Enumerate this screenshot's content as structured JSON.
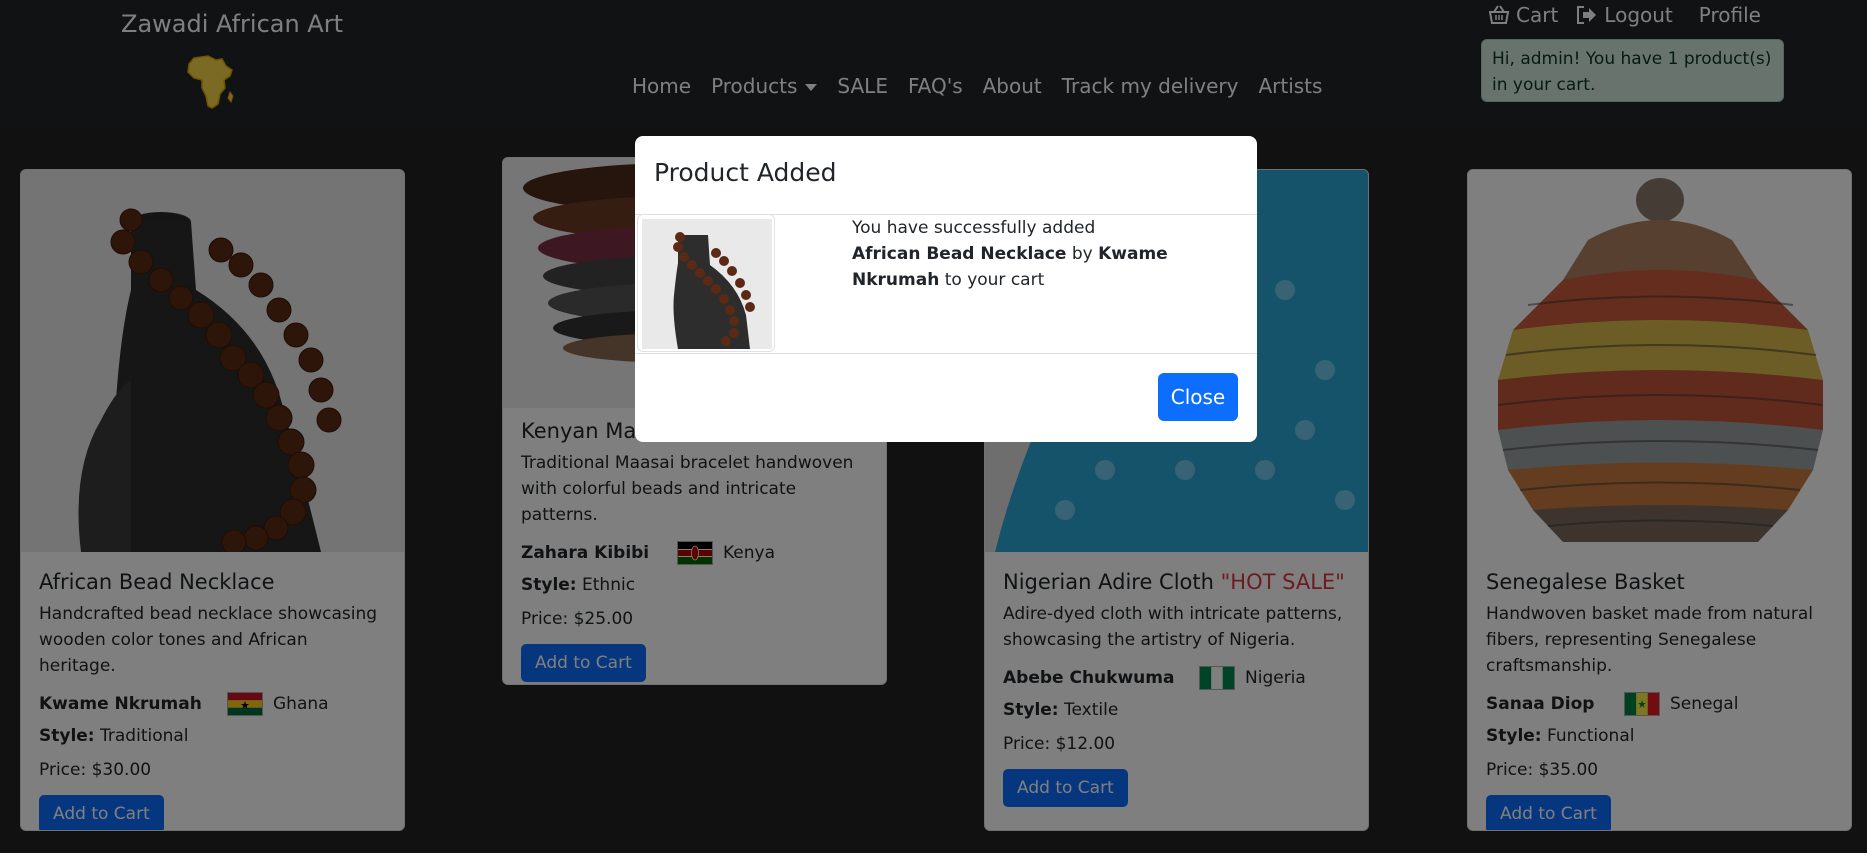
{
  "navbar": {
    "brand": "Zawadi African Art",
    "links": [
      "Home",
      "Products",
      "SALE",
      "FAQ's",
      "About",
      "Track my delivery",
      "Artists"
    ],
    "cart_label": "Cart",
    "logout_label": "Logout",
    "profile_label": "Profile",
    "alert_text": "Hi, admin! You have 1 product(s) in your cart."
  },
  "products": [
    {
      "name": "African Bead Necklace",
      "sale_tag": "",
      "description": "Handcrafted bead necklace showcasing wooden color tones and African heritage.",
      "artist": "Kwame Nkrumah",
      "country": "Ghana",
      "style_label": "Style:",
      "style": "Traditional",
      "price": "Price: $30.00",
      "button": "Add to Cart"
    },
    {
      "name": "Kenyan Maasai Bracelet",
      "sale_tag": "",
      "description": "Traditional Maasai bracelet handwoven with colorful beads and intricate patterns.",
      "artist": "Zahara Kibibi",
      "country": "Kenya",
      "style_label": "Style:",
      "style": "Ethnic",
      "price": "Price: $25.00",
      "button": "Add to Cart"
    },
    {
      "name": "Nigerian Adire Cloth",
      "sale_tag": "\"HOT SALE\"",
      "description": "Adire-dyed cloth with intricate patterns, showcasing the artistry of Nigeria.",
      "artist": "Abebe Chukwuma",
      "country": "Nigeria",
      "style_label": "Style:",
      "style": "Textile",
      "price": "Price: $12.00",
      "button": "Add to Cart"
    },
    {
      "name": "Senegalese Basket",
      "sale_tag": "",
      "description": "Handwoven basket made from natural fibers, representing Senegalese craftsmanship.",
      "artist": "Sanaa Diop",
      "country": "Senegal",
      "style_label": "Style:",
      "style": "Functional",
      "price": "Price: $35.00",
      "button": "Add to Cart"
    }
  ],
  "modal": {
    "title": "Product Added",
    "line1": "You have successfully added",
    "product": "African Bead Necklace",
    "by": "by",
    "artist": "Kwame Nkrumah",
    "suffix": "to your cart",
    "close_label": "Close"
  },
  "colors": {
    "navbar_bg": "#212529",
    "primary": "#0d6efd",
    "sale": "#dc3545",
    "alert_bg": "#d1e7dd"
  }
}
